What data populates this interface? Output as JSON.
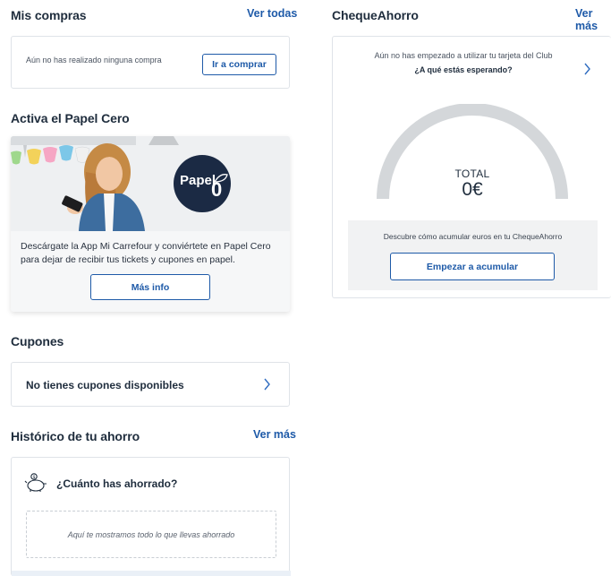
{
  "mis_compras": {
    "title": "Mis compras",
    "link": "Ver todas",
    "empty_text": "Aún no has realizado ninguna compra",
    "button": "Ir a comprar"
  },
  "papel_cero": {
    "title": "Activa el Papel Cero",
    "badge_word": "Papel",
    "badge_zero": "0",
    "description": "Descárgate la App Mi Carrefour y conviértete en Papel Cero para dejar de recibir tus tickets y cupones en papel.",
    "button": "Más info"
  },
  "cupones": {
    "title": "Cupones",
    "empty_text": "No tienes cupones disponibles"
  },
  "historico": {
    "title": "Histórico de tu ahorro",
    "link": "Ver más",
    "question": "¿Cuánto has ahorrado?",
    "placeholder": "Aquí te mostramos todo lo que llevas ahorrado"
  },
  "cheque_ahorro": {
    "title": "ChequeAhorro",
    "link": "Ver más",
    "intro_line1": "Aún no has empezado a utilizar tu tarjeta del Club",
    "intro_line2": "¿A qué estás esperando?",
    "total_label": "TOTAL",
    "total_value": "0€",
    "gauge_fraction": 0,
    "cta_text": "Descubre cómo acumular euros en tu ChequeAhorro",
    "button": "Empezar a acumular"
  },
  "colors": {
    "brand_blue": "#1e5aa8",
    "gauge_grey": "#d4d7da",
    "navy_badge": "#1b2a44"
  },
  "icons": [
    "chevron-right-icon",
    "piggy-bank-icon",
    "papel-cero-leaf-icon"
  ]
}
